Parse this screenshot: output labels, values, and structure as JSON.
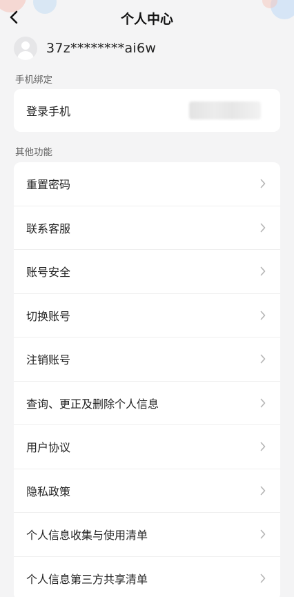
{
  "header": {
    "title": "个人中心",
    "back_icon": "chevron-left-icon"
  },
  "user": {
    "avatar_icon": "avatar-placeholder-icon",
    "username": "37z********ai6w"
  },
  "phone_section": {
    "label": "手机绑定",
    "item_label": "登录手机"
  },
  "other_section": {
    "label": "其他功能",
    "items": [
      {
        "label": "重置密码"
      },
      {
        "label": "联系客服"
      },
      {
        "label": "账号安全"
      },
      {
        "label": "切换账号"
      },
      {
        "label": "注销账号"
      },
      {
        "label": "查询、更正及删除个人信息"
      },
      {
        "label": "用户协议"
      },
      {
        "label": "隐私政策"
      },
      {
        "label": "个人信息收集与使用清单"
      },
      {
        "label": "个人信息第三方共享清单"
      }
    ]
  },
  "colors": {
    "background": "#f4f4f5",
    "card": "#ffffff",
    "text": "#222222",
    "muted": "#666666",
    "chevron": "#b5b5b5"
  }
}
